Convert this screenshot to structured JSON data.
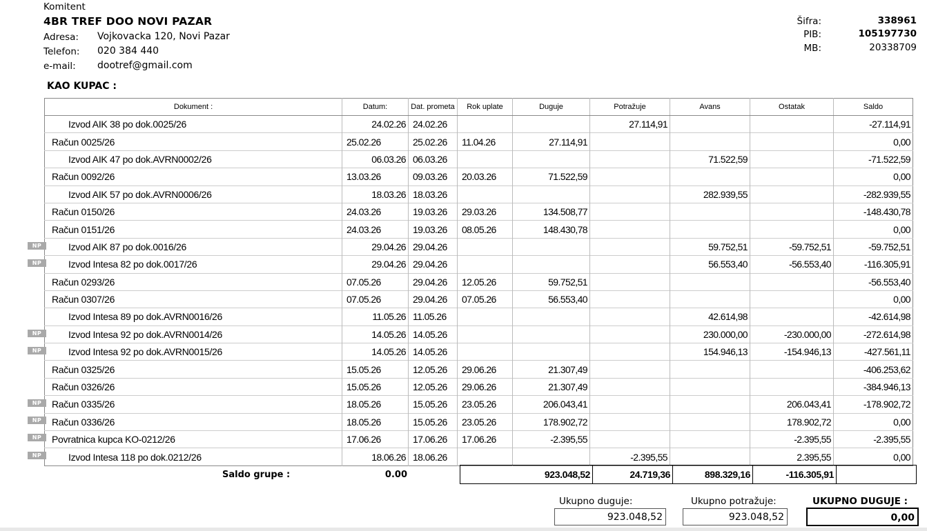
{
  "client": {
    "label": "Komitent",
    "name": "4BR TREF DOO NOVI PAZAR",
    "address_label": "Adresa:",
    "address": "Vojkovacka 120, Novi Pazar",
    "phone_label": "Telefon:",
    "phone": "020 384 440",
    "email_label": "e-mail:",
    "email": "dootref@gmail.com",
    "sifra_label": "Šifra:",
    "sifra": "338961",
    "pib_label": "PIB:",
    "pib": "105197730",
    "mb_label": "MB:",
    "mb": "20338709"
  },
  "section_title": "KAO KUPAC :",
  "table": {
    "headers": [
      "Dokument :",
      "Datum:",
      "Dat. prometa",
      "Rok uplate",
      "Duguje",
      "Potražuje",
      "Avans",
      "Ostatak",
      "Saldo"
    ],
    "rows": [
      {
        "np": false,
        "indent": true,
        "doc": "Izvod AIK  38  po dok.0025/26",
        "datum": "24.02.26",
        "promet": "24.02.26",
        "rok": "",
        "duguje": "",
        "potrazuje": "27.114,91",
        "avans": "",
        "ostatak": "",
        "saldo": "-27.114,91"
      },
      {
        "np": false,
        "indent": false,
        "doc": "Račun  0025/26",
        "datum": "25.02.26",
        "promet": "25.02.26",
        "rok": "11.04.26",
        "duguje": "27.114,91",
        "potrazuje": "",
        "avans": "",
        "ostatak": "",
        "saldo": "0,00"
      },
      {
        "np": false,
        "indent": true,
        "doc": "Izvod AIK  47  po dok.AVRN0002/26",
        "datum": "06.03.26",
        "promet": "06.03.26",
        "rok": "",
        "duguje": "",
        "potrazuje": "",
        "avans": "71.522,59",
        "ostatak": "",
        "saldo": "-71.522,59"
      },
      {
        "np": false,
        "indent": false,
        "doc": "Račun  0092/26",
        "datum": "13.03.26",
        "promet": "09.03.26",
        "rok": "20.03.26",
        "duguje": "71.522,59",
        "potrazuje": "",
        "avans": "",
        "ostatak": "",
        "saldo": "0,00"
      },
      {
        "np": false,
        "indent": true,
        "doc": "Izvod AIK  57  po dok.AVRN0006/26",
        "datum": "18.03.26",
        "promet": "18.03.26",
        "rok": "",
        "duguje": "",
        "potrazuje": "",
        "avans": "282.939,55",
        "ostatak": "",
        "saldo": "-282.939,55"
      },
      {
        "np": false,
        "indent": false,
        "doc": "Račun  0150/26",
        "datum": "24.03.26",
        "promet": "19.03.26",
        "rok": "29.03.26",
        "duguje": "134.508,77",
        "potrazuje": "",
        "avans": "",
        "ostatak": "",
        "saldo": "-148.430,78"
      },
      {
        "np": false,
        "indent": false,
        "doc": "Račun  0151/26",
        "datum": "24.03.26",
        "promet": "19.03.26",
        "rok": "08.05.26",
        "duguje": "148.430,78",
        "potrazuje": "",
        "avans": "",
        "ostatak": "",
        "saldo": "0,00"
      },
      {
        "np": true,
        "indent": true,
        "doc": "Izvod AIK  87  po dok.0016/26",
        "datum": "29.04.26",
        "promet": "29.04.26",
        "rok": "",
        "duguje": "",
        "potrazuje": "",
        "avans": "59.752,51",
        "ostatak": "-59.752,51",
        "saldo": "-59.752,51"
      },
      {
        "np": true,
        "indent": true,
        "doc": "Izvod Intesa  82  po dok.0017/26",
        "datum": "29.04.26",
        "promet": "29.04.26",
        "rok": "",
        "duguje": "",
        "potrazuje": "",
        "avans": "56.553,40",
        "ostatak": "-56.553,40",
        "saldo": "-116.305,91"
      },
      {
        "np": false,
        "indent": false,
        "doc": "Račun  0293/26",
        "datum": "07.05.26",
        "promet": "29.04.26",
        "rok": "12.05.26",
        "duguje": "59.752,51",
        "potrazuje": "",
        "avans": "",
        "ostatak": "",
        "saldo": "-56.553,40"
      },
      {
        "np": false,
        "indent": false,
        "doc": "Račun  0307/26",
        "datum": "07.05.26",
        "promet": "29.04.26",
        "rok": "07.05.26",
        "duguje": "56.553,40",
        "potrazuje": "",
        "avans": "",
        "ostatak": "",
        "saldo": "0,00"
      },
      {
        "np": false,
        "indent": true,
        "doc": "Izvod Intesa  89  po dok.AVRN0016/26",
        "datum": "11.05.26",
        "promet": "11.05.26",
        "rok": "",
        "duguje": "",
        "potrazuje": "",
        "avans": "42.614,98",
        "ostatak": "",
        "saldo": "-42.614,98"
      },
      {
        "np": true,
        "indent": true,
        "doc": "Izvod Intesa  92  po dok.AVRN0014/26",
        "datum": "14.05.26",
        "promet": "14.05.26",
        "rok": "",
        "duguje": "",
        "potrazuje": "",
        "avans": "230.000,00",
        "ostatak": "-230.000,00",
        "saldo": "-272.614,98"
      },
      {
        "np": true,
        "indent": true,
        "doc": "Izvod Intesa  92  po dok.AVRN0015/26",
        "datum": "14.05.26",
        "promet": "14.05.26",
        "rok": "",
        "duguje": "",
        "potrazuje": "",
        "avans": "154.946,13",
        "ostatak": "-154.946,13",
        "saldo": "-427.561,11"
      },
      {
        "np": false,
        "indent": false,
        "doc": "Račun  0325/26",
        "datum": "15.05.26",
        "promet": "12.05.26",
        "rok": "29.06.26",
        "duguje": "21.307,49",
        "potrazuje": "",
        "avans": "",
        "ostatak": "",
        "saldo": "-406.253,62"
      },
      {
        "np": false,
        "indent": false,
        "doc": "Račun  0326/26",
        "datum": "15.05.26",
        "promet": "12.05.26",
        "rok": "29.06.26",
        "duguje": "21.307,49",
        "potrazuje": "",
        "avans": "",
        "ostatak": "",
        "saldo": "-384.946,13"
      },
      {
        "np": true,
        "indent": false,
        "doc": "Račun  0335/26",
        "datum": "18.05.26",
        "promet": "15.05.26",
        "rok": "23.05.26",
        "duguje": "206.043,41",
        "potrazuje": "",
        "avans": "",
        "ostatak": "206.043,41",
        "saldo": "-178.902,72"
      },
      {
        "np": true,
        "indent": false,
        "doc": "Račun  0336/26",
        "datum": "18.05.26",
        "promet": "15.05.26",
        "rok": "23.05.26",
        "duguje": "178.902,72",
        "potrazuje": "",
        "avans": "",
        "ostatak": "178.902,72",
        "saldo": "0,00"
      },
      {
        "np": true,
        "indent": false,
        "doc": "Povratnica kupca  KO-0212/26",
        "datum": "17.06.26",
        "promet": "17.06.26",
        "rok": "17.06.26",
        "duguje": "-2.395,55",
        "potrazuje": "",
        "avans": "",
        "ostatak": "-2.395,55",
        "saldo": "-2.395,55"
      },
      {
        "np": true,
        "indent": true,
        "doc": "Izvod Intesa  118  po dok.0212/26",
        "datum": "18.06.26",
        "promet": "18.06.26",
        "rok": "",
        "duguje": "",
        "potrazuje": "-2.395,55",
        "avans": "",
        "ostatak": "2.395,55",
        "saldo": "0,00"
      }
    ],
    "np_label": "NP"
  },
  "summary": {
    "label": "Saldo grupe :",
    "value": "0.00",
    "duguje": "923.048,52",
    "potrazuje": "24.719,36",
    "avans": "898.329,16",
    "ostatak": "-116.305,91",
    "saldo": ""
  },
  "totals": {
    "duguje_label": "Ukupno duguje:",
    "duguje": "923.048,52",
    "potrazuje_label": "Ukupno potražuje:",
    "potrazuje": "923.048,52",
    "ukupno_label": "UKUPNO DUGUJE :",
    "ukupno": "0,00"
  }
}
